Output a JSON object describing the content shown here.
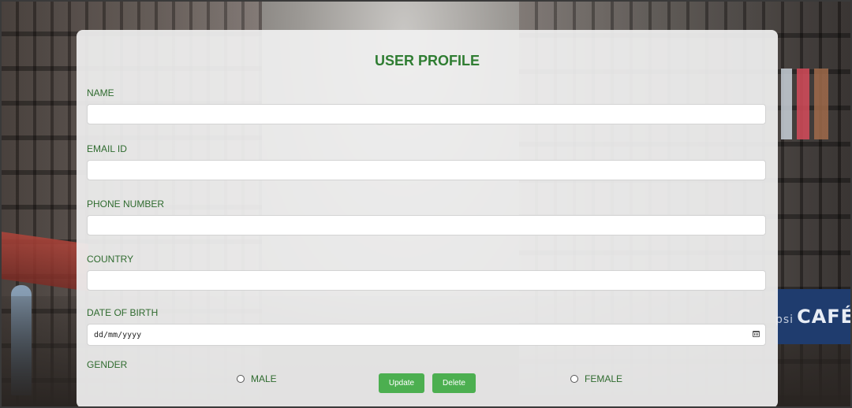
{
  "form": {
    "title": "USER PROFILE",
    "fields": [
      {
        "label": "NAME",
        "value": "",
        "placeholder": ""
      },
      {
        "label": "EMAIL ID",
        "value": "",
        "placeholder": ""
      },
      {
        "label": "PHONE NUMBER",
        "value": "",
        "placeholder": ""
      },
      {
        "label": "COUNTRY",
        "value": "",
        "placeholder": ""
      }
    ],
    "dob": {
      "label": "DATE OF BIRTH",
      "placeholder": "dd/mm/yyyy",
      "icon": "calendar-icon"
    },
    "gender": {
      "label": "GENDER",
      "options": [
        {
          "label": "MALE",
          "selected": false
        },
        {
          "label": "FEMALE",
          "selected": false
        }
      ]
    },
    "buttons": {
      "update": "Update",
      "delete": "Delete"
    }
  },
  "background": {
    "sign_text_small": "psi",
    "sign_text": "CAFÉ"
  },
  "colors": {
    "accent": "#2f7d32",
    "label": "#2f6b2f",
    "button": "#4caf50",
    "button_text": "#ffffff",
    "card": "#f0f0f0"
  }
}
